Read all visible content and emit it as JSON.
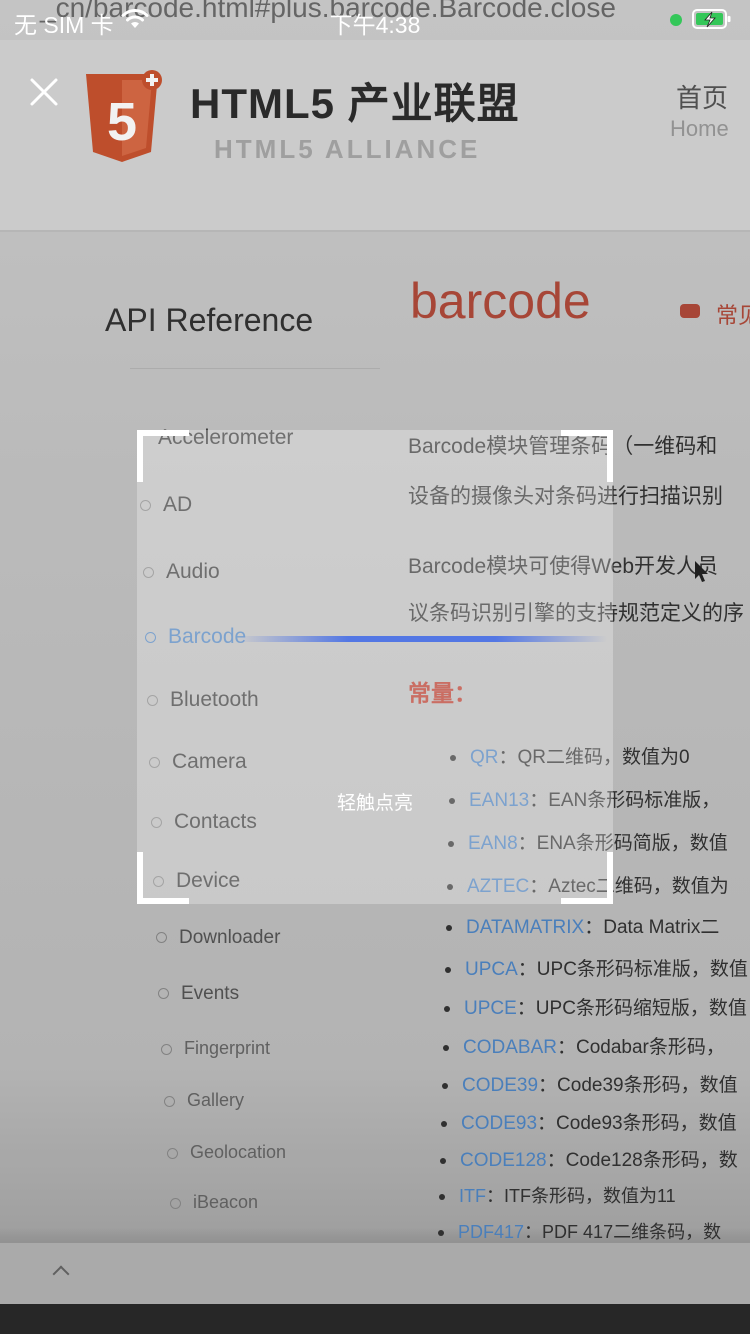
{
  "status_bar": {
    "carrier": "无 SIM 卡",
    "time": "下午4:38",
    "location_dot_color": "#34c759"
  },
  "scanner": {
    "close_icon": "close-icon",
    "torch_hint": "轻触点亮"
  },
  "camera_view": {
    "url_fragment": "_cn/barcode.html#plus.barcode.Barcode.close",
    "logo_title": "HTML5 产业联盟",
    "logo_subtitle": "HTML5 ALLIANCE",
    "logo_badge": "5",
    "nav_home": "首页",
    "nav_home_en": "Home",
    "api_reference": "API Reference",
    "page_title": "barcode",
    "faq_link": "常见",
    "sidebar_items": [
      "Accelerometer",
      "AD",
      "Audio",
      "Barcode",
      "Bluetooth",
      "Camera",
      "Contacts",
      "Device",
      "Downloader",
      "Events",
      "Fingerprint",
      "Gallery",
      "Geolocation",
      "iBeacon"
    ],
    "paragraph1_line1": "Barcode模块管理条码（一维码和",
    "paragraph1_line2": "设备的摄像头对条码进行扫描识别",
    "paragraph2_line1": "Barcode模块可使得Web开发人员",
    "paragraph2_line2": "议条码识别引擎的支持规范定义的序",
    "constants_heading": "常量：",
    "constants": [
      {
        "key": "QR",
        "desc": "：QR二维码，数值为0"
      },
      {
        "key": "EAN13",
        "desc": "：EAN条形码标准版，"
      },
      {
        "key": "EAN8",
        "desc": "：ENA条形码简版，数值"
      },
      {
        "key": "AZTEC",
        "desc": "：Aztec二维码，数值为"
      },
      {
        "key": "DATAMATRIX",
        "desc": "：Data Matrix二"
      },
      {
        "key": "UPCA",
        "desc": "：UPC条形码标准版，数值"
      },
      {
        "key": "UPCE",
        "desc": "：UPC条形码缩短版，数值"
      },
      {
        "key": "CODABAR",
        "desc": "：Codabar条形码，"
      },
      {
        "key": "CODE39",
        "desc": "：Code39条形码，数值"
      },
      {
        "key": "CODE93",
        "desc": "：Code93条形码，数值"
      },
      {
        "key": "CODE128",
        "desc": "：Code128条形码，数"
      },
      {
        "key": "ITF",
        "desc": "：ITF条形码，数值为11"
      },
      {
        "key": "PDF417",
        "desc": "：PDF 417二维条码，数"
      }
    ]
  },
  "colors": {
    "scan_line": "#4a6fe6",
    "frame_corners": "#ffffff",
    "link_blue": "#4f86c6",
    "title_red": "#b04a3a"
  }
}
